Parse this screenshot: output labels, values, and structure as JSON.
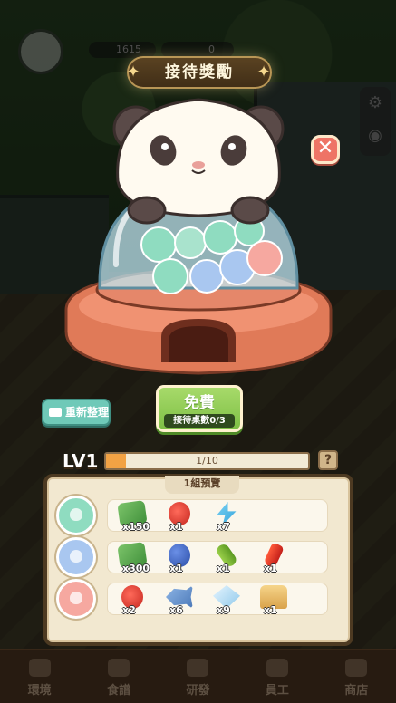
{
  "hud": {
    "coins": "1615",
    "gems": "0"
  },
  "title": "接待獎勵",
  "close_label": "✕",
  "buttons": {
    "refresh_label": "重新整理",
    "free_label": "免費",
    "free_sub": "接待桌數0/3"
  },
  "level": {
    "label": "LV1",
    "progress_text": "1/10",
    "progress_fraction": 0.1,
    "help_label": "?"
  },
  "panel": {
    "title": "1組預覽",
    "rows": [
      {
        "ball_color": "#8fdcc0",
        "items": [
          {
            "icon": "cash-icon",
            "qty": "x150"
          },
          {
            "icon": "apple-icon",
            "qty": "x1"
          },
          {
            "icon": "lightning-icon",
            "qty": "x7"
          }
        ]
      },
      {
        "ball_color": "#a9c7f0",
        "items": [
          {
            "icon": "cash-icon",
            "qty": "x300"
          },
          {
            "icon": "blueberry-icon",
            "qty": "x1"
          },
          {
            "icon": "cucumber-icon",
            "qty": "x1"
          },
          {
            "icon": "chili-icon",
            "qty": "x1"
          }
        ]
      },
      {
        "ball_color": "#f6a8a0",
        "items": [
          {
            "icon": "apple-icon",
            "qty": "x2"
          },
          {
            "icon": "fish-icon",
            "qty": "x6"
          },
          {
            "icon": "diamond-icon",
            "qty": "x9"
          },
          {
            "icon": "toast-icon",
            "qty": "x1"
          }
        ]
      }
    ]
  },
  "tabs": [
    {
      "label": "環境"
    },
    {
      "label": "食譜"
    },
    {
      "label": "研發"
    },
    {
      "label": "員工"
    },
    {
      "label": "商店"
    }
  ],
  "colors": {
    "accent_green": "#7ebf45",
    "machine_orange": "#e07a58",
    "progress": "#f2a244"
  }
}
